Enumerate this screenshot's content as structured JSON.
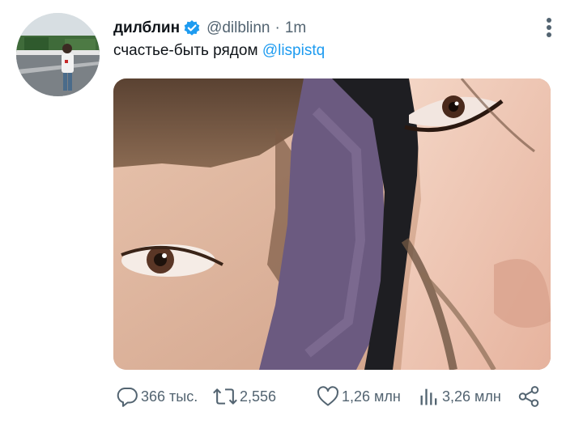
{
  "tweet": {
    "author": {
      "display_name": "дилблин",
      "handle": "@dilblinn",
      "verified": true
    },
    "separator": "·",
    "time": "1m",
    "text": "счастье-быть рядом",
    "mention": "@lispistq",
    "media": {
      "kind": "selfie photo"
    },
    "actions": {
      "replies": "366 тыс.",
      "retweets": "2,556",
      "likes": "1,26 млн",
      "views": "3,26 млн"
    }
  },
  "icons": {
    "verified": "verified-badge-icon",
    "more": "more-options-icon",
    "reply": "reply-icon",
    "retweet": "retweet-icon",
    "like": "heart-icon",
    "views": "views-chart-icon",
    "share": "share-icon"
  },
  "colors": {
    "accent": "#1d9bf0",
    "text": "#0f1419",
    "secondary": "#536471"
  }
}
